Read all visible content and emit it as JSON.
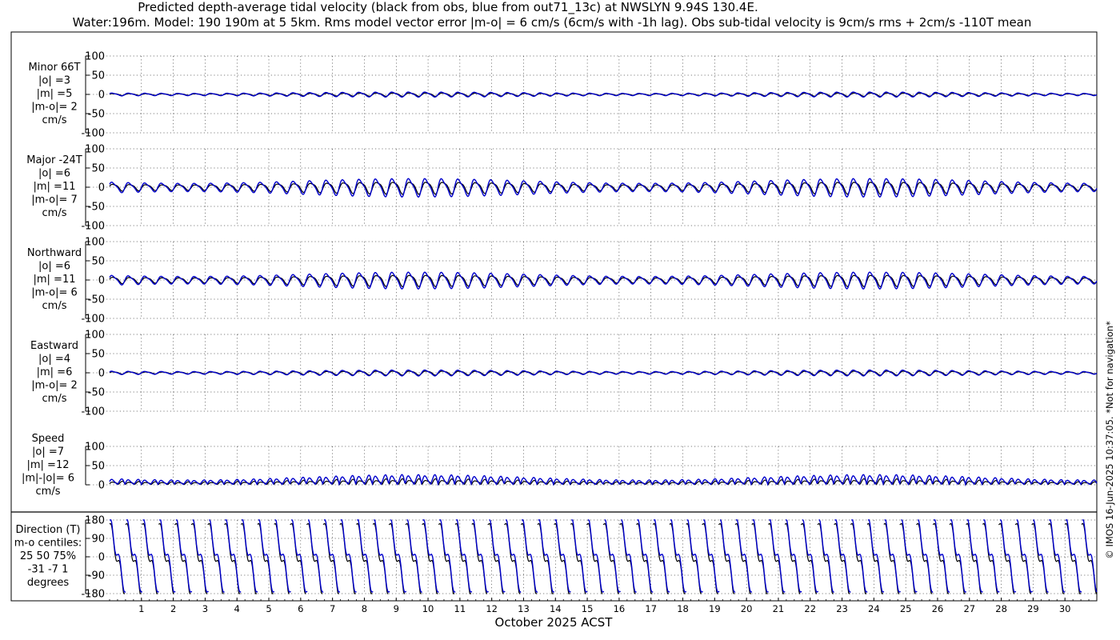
{
  "title": {
    "line1": "Predicted depth-average tidal velocity (black from obs, blue from out71_13c) at NWSLYN 9.94S 130.4E.",
    "line2": "Water:196m. Model: 190 190m at 5 5km. Rms model vector error |m-o| = 6 cm/s (6cm/s with -1h lag). Obs sub-tidal velocity is 9cm/s rms + 2cm/s -110T mean"
  },
  "xlabel": "October 2025 ACST",
  "copyright": "© IMOS 16-Jun-2025 10:37:05. *Not for navigation*",
  "colors": {
    "obs": "#000000",
    "model": "#0000cc",
    "grid": "#000000"
  },
  "chart_data": [
    {
      "type": "line",
      "name": "minor",
      "label_lines": [
        "Minor 66T",
        "|o| =3",
        "|m| =5",
        "|m-o|= 2",
        "cm/s"
      ],
      "ylim": [
        -100,
        100
      ],
      "yticks": [
        "100",
        "50",
        "0",
        "-50",
        "-100"
      ],
      "series": [
        {
          "name": "obs",
          "color": "#000000",
          "amplitude": 4,
          "period_h": 12.42
        },
        {
          "name": "model",
          "color": "#0000cc",
          "amplitude": 6,
          "period_h": 12.42
        }
      ]
    },
    {
      "type": "line",
      "name": "major",
      "label_lines": [
        "Major -24T",
        "|o| =6",
        "|m| =11",
        "|m-o|= 7",
        "cm/s"
      ],
      "ylim": [
        -100,
        100
      ],
      "yticks": [
        "100",
        "50",
        "0",
        "-50",
        "-100"
      ],
      "series": [
        {
          "name": "obs",
          "color": "#000000",
          "amplitude": 15,
          "period_h": 12.42
        },
        {
          "name": "model",
          "color": "#0000cc",
          "amplitude": 22,
          "period_h": 12.42
        }
      ]
    },
    {
      "type": "line",
      "name": "northward",
      "label_lines": [
        "Northward",
        "|o| =6",
        "|m| =11",
        "|m-o|= 6",
        "cm/s"
      ],
      "ylim": [
        -100,
        100
      ],
      "yticks": [
        "100",
        "50",
        "0",
        "-50",
        "-100"
      ],
      "series": [
        {
          "name": "obs",
          "color": "#000000",
          "amplitude": 14,
          "period_h": 12.42
        },
        {
          "name": "model",
          "color": "#0000cc",
          "amplitude": 20,
          "period_h": 12.42
        }
      ]
    },
    {
      "type": "line",
      "name": "eastward",
      "label_lines": [
        "Eastward",
        "|o| =4",
        "|m| =6",
        "|m-o|= 2",
        "cm/s"
      ],
      "ylim": [
        -100,
        100
      ],
      "yticks": [
        "100",
        "50",
        "0",
        "-50",
        "-100"
      ],
      "series": [
        {
          "name": "obs",
          "color": "#000000",
          "amplitude": 5,
          "period_h": 12.42
        },
        {
          "name": "model",
          "color": "#0000cc",
          "amplitude": 7,
          "period_h": 12.42
        }
      ]
    },
    {
      "type": "line",
      "name": "speed",
      "label_lines": [
        "Speed",
        "|o| =7",
        "|m| =12",
        "|m|-|o|= 6",
        "cm/s"
      ],
      "ylim": [
        0,
        100
      ],
      "yticks": [
        "100",
        "50",
        "0"
      ],
      "series": [
        {
          "name": "obs",
          "color": "#000000",
          "amplitude": 12,
          "period_h": 12.42
        },
        {
          "name": "model",
          "color": "#0000cc",
          "amplitude": 22,
          "period_h": 12.42
        }
      ]
    },
    {
      "type": "line",
      "name": "direction",
      "label_lines": [
        "Direction (T)",
        "m-o centiles:",
        "25  50  75%",
        "-31  -7   1",
        "degrees"
      ],
      "ylim": [
        -180,
        180
      ],
      "yticks": [
        "180",
        "90",
        "0",
        "-90",
        "-180"
      ],
      "series": [
        {
          "name": "obs",
          "color": "#000000",
          "period_h": 12.42
        },
        {
          "name": "model",
          "color": "#0000cc",
          "period_h": 12.42
        }
      ]
    }
  ],
  "x_axis": {
    "days": [
      "1",
      "2",
      "3",
      "4",
      "5",
      "6",
      "7",
      "8",
      "9",
      "10",
      "11",
      "12",
      "13",
      "14",
      "15",
      "16",
      "17",
      "18",
      "19",
      "20",
      "21",
      "22",
      "23",
      "24",
      "25",
      "26",
      "27",
      "28",
      "29",
      "30"
    ],
    "range_days": [
      0,
      31
    ]
  }
}
